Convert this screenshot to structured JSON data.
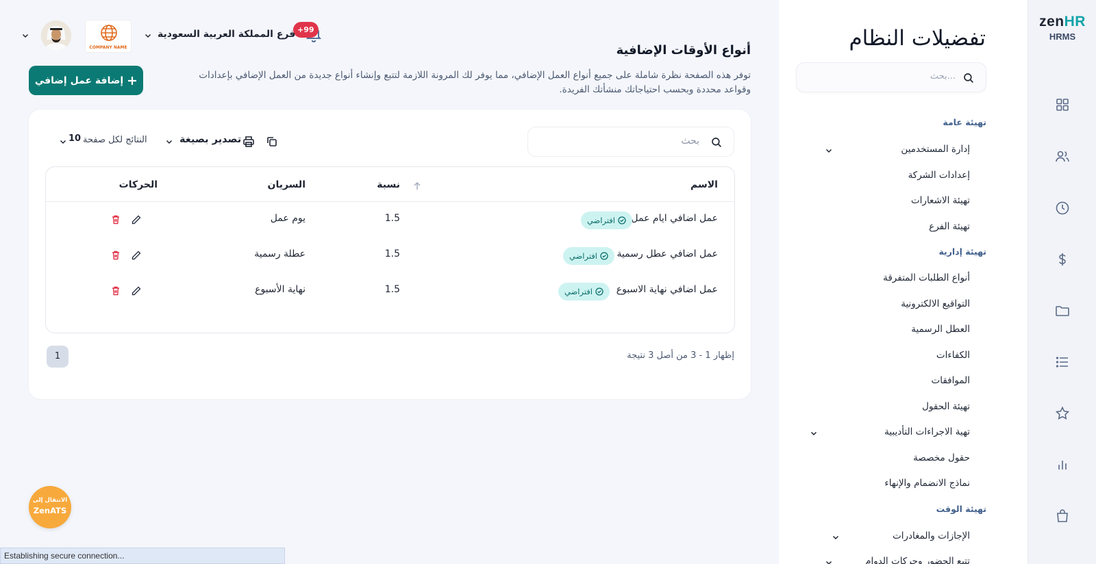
{
  "brand": {
    "name_part1": "zen",
    "name_part2": "HR",
    "sub": "HRMS"
  },
  "header": {
    "notification_count": "+99",
    "branch": "فرع المملكة العربية السعودية",
    "company_logo_text": "COMPANY NAME"
  },
  "sidebar": {
    "title": "تفضيلات النظام",
    "search_placeholder": "بحث...",
    "sections": {
      "general": "تهيئة عامة",
      "admin": "تهيئة إدارية",
      "time": "تهيئة الوقت"
    },
    "items": [
      "إدارة المستخدمين",
      "إعدادات الشركة",
      "تهيئة الاشعارات",
      "تهيئة الفرع",
      "أنواع الطلبات المتفرقة",
      "التواقيع الالكترونية",
      "العطل الرسمية",
      "الكفاءات",
      "الموافقات",
      "تهيئة الحقول",
      "تهية الاجراءات التأديبية",
      "حقول مخصصة",
      "نماذج الانضمام والإنهاء",
      "الإجازات والمغادرات",
      "تتبع الحضور وحركات الدوام"
    ]
  },
  "page": {
    "title": "أنواع الأوقات الإضافية",
    "description": "توفر هذه الصفحة نظرة شاملة على جميع أنواع العمل الإضافي، مما يوفر لك المرونة اللازمة لتتبع وإنشاء أنواع جديدة من العمل الإضافي بإعدادات وقواعد محددة وبحسب احتياجاتك منشأتك الفريدة.",
    "add_button": "إضافة عمل إضافي"
  },
  "toolbar": {
    "search_placeholder": "بحث",
    "export_label": "تصدير بصيغة",
    "per_page_label": "النتائج لكل صفحة",
    "per_page_value": "10"
  },
  "table": {
    "headers": {
      "name": "الاسم",
      "rate": "نسبة",
      "applies": "السريان",
      "actions": "الحركات"
    },
    "default_badge": "افتراضي",
    "rows": [
      {
        "name": "عمل اضافي ايام عمل",
        "rate": "1.5",
        "applies": "يوم عمل"
      },
      {
        "name": "عمل اضافي عطل رسمية",
        "rate": "1.5",
        "applies": "عطلة رسمية"
      },
      {
        "name": "عمل اضافي نهاية الاسبوع",
        "rate": "1.5",
        "applies": "نهاية الأسبوع"
      }
    ]
  },
  "pagination": {
    "page": "1",
    "showing": "إظهار 1 - 3 من أصل 3 نتيجة"
  },
  "ats_button": {
    "line1": "الانتقال إلى",
    "line2": "ZenATS"
  },
  "status_bar": "Establishing secure connection...",
  "colors": {
    "primary": "#0b7a74",
    "badge": "#e0344a",
    "pill_bg": "#cdf3f1",
    "ats": "#f7a93c"
  }
}
